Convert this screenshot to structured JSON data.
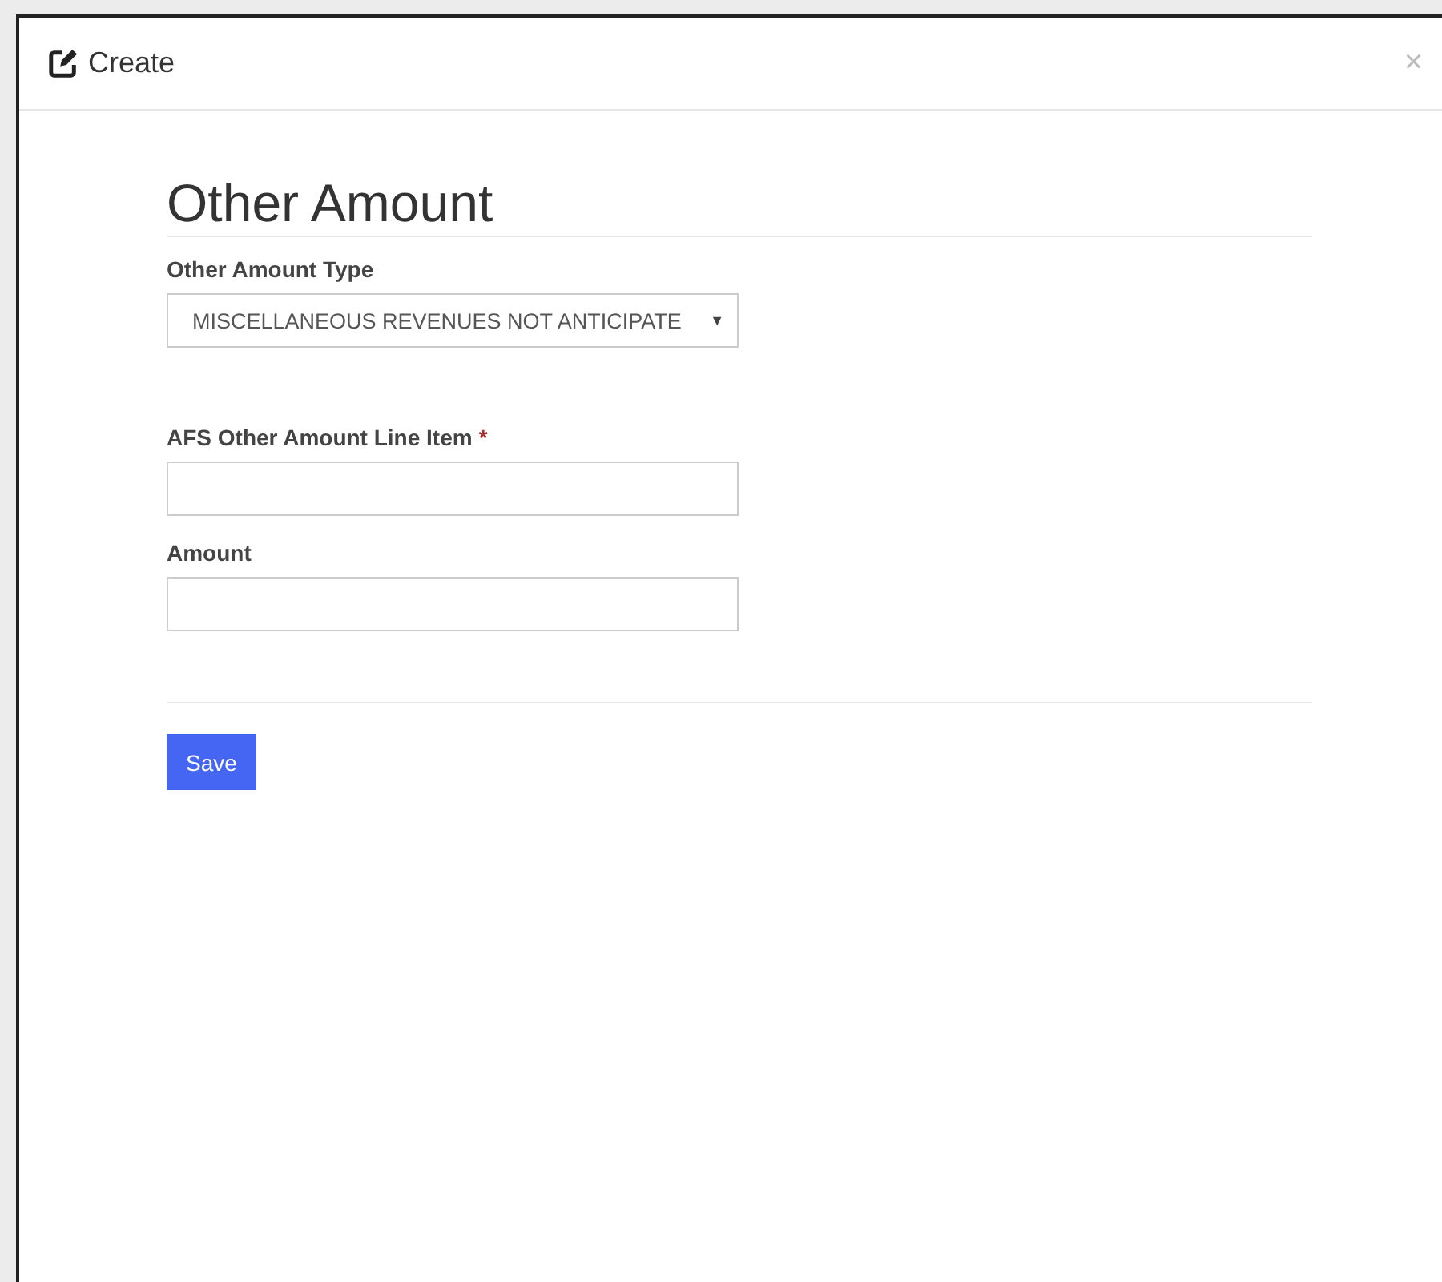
{
  "dialog": {
    "title": "Create",
    "close": "×"
  },
  "form": {
    "heading": "Other Amount",
    "fields": [
      {
        "kind": "select",
        "label": "Other Amount Type",
        "value": "MISCELLANEOUS REVENUES NOT ANTICIPATE",
        "caret": "▼"
      },
      {
        "kind": "text",
        "label": "AFS Other Amount Line Item",
        "required_mark": "*"
      },
      {
        "kind": "text",
        "label": "Amount"
      }
    ],
    "save_button": "Save"
  }
}
